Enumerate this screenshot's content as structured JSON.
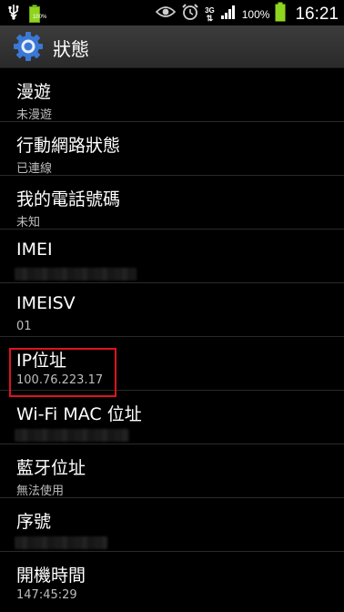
{
  "status_bar": {
    "battery_small": "100%",
    "network": "3G",
    "battery_percent": "100%",
    "time": "16:21"
  },
  "action_bar": {
    "title": "狀態"
  },
  "items": [
    {
      "title": "漫遊",
      "summary": "未漫遊"
    },
    {
      "title": "行動網路狀態",
      "summary": "已連線"
    },
    {
      "title": "我的電話號碼",
      "summary": "未知"
    },
    {
      "title": "IMEI",
      "summary": ""
    },
    {
      "title": "IMEISV",
      "summary": "01"
    },
    {
      "title": "IP位址",
      "summary": "100.76.223.17"
    },
    {
      "title": "Wi-Fi MAC 位址",
      "summary": ""
    },
    {
      "title": "藍牙位址",
      "summary": "無法使用"
    },
    {
      "title": "序號",
      "summary": ""
    },
    {
      "title": "開機時間",
      "summary": "147:45:29"
    }
  ],
  "colors": {
    "highlight": "#e0121e",
    "battery": "#8fd41f"
  }
}
